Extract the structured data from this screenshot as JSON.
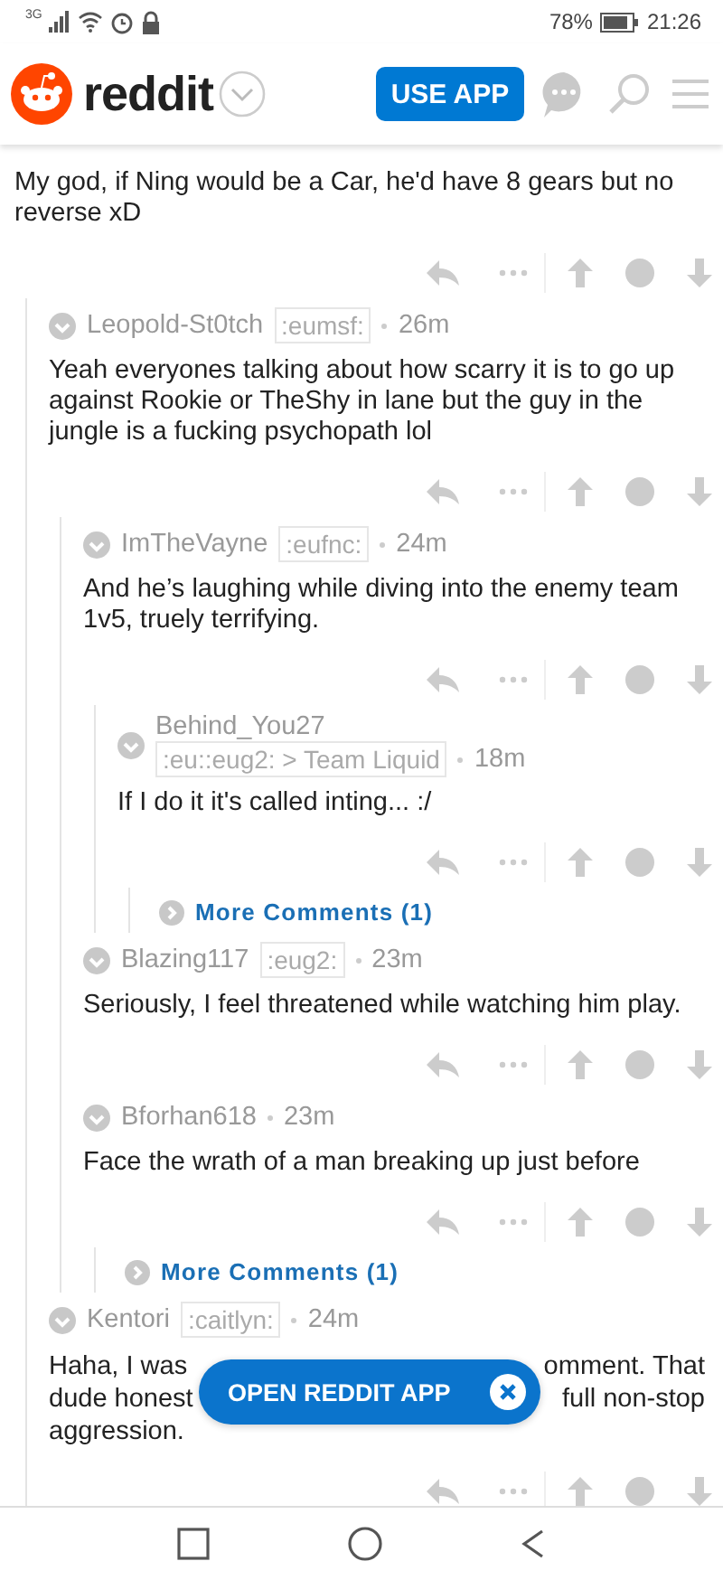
{
  "status_bar": {
    "network": "3G",
    "battery": "78%",
    "time": "21:26"
  },
  "header": {
    "brand": "reddit",
    "use_app": "USE APP"
  },
  "comments": [
    {
      "kind": "comment",
      "body": "My god, if Ning would be a Car, he'd have 8 gears but no reverse xD",
      "children": [
        {
          "kind": "comment",
          "user": "Leopold-St0tch",
          "flair": ":eumsf:",
          "time": "26m",
          "body": "Yeah everyones talking about how scarry it is to go up against Rookie or TheShy in lane but the guy in the jungle is a fucking psychopath lol",
          "children": [
            {
              "kind": "comment",
              "user": "ImTheVayne",
              "flair": ":eufnc:",
              "time": "24m",
              "body": "And he’s laughing while diving into the enemy team 1v5, truely terrifying.",
              "children": [
                {
                  "kind": "comment",
                  "user": "Behind_You27",
                  "flair": ":eu::eug2: > Team Liquid",
                  "time": "18m",
                  "stacked": true,
                  "body": "If I do it it's called inting... :/",
                  "children": [
                    {
                      "kind": "more",
                      "label": "More Comments (1)"
                    }
                  ]
                }
              ]
            },
            {
              "kind": "comment",
              "user": "Blazing117",
              "flair": ":eug2:",
              "time": "23m",
              "body": "Seriously, I feel threatened while watching him play."
            },
            {
              "kind": "comment",
              "user": "Bforhan618",
              "time": "23m",
              "body": "Face the wrath of a man breaking up just before",
              "children": [
                {
                  "kind": "more",
                  "label": "More Comments (1)"
                }
              ]
            }
          ]
        },
        {
          "kind": "comment",
          "user": "Kentori",
          "flair": ":caitlyn:",
          "time": "24m",
          "body_lines": [
            {
              "left": "Haha, I was",
              "right": "omment. That"
            },
            {
              "left": "dude honest",
              "right": "full non-stop"
            },
            {
              "left": "aggression."
            }
          ]
        }
      ]
    }
  ],
  "popup": {
    "label": "OPEN REDDIT APP"
  }
}
